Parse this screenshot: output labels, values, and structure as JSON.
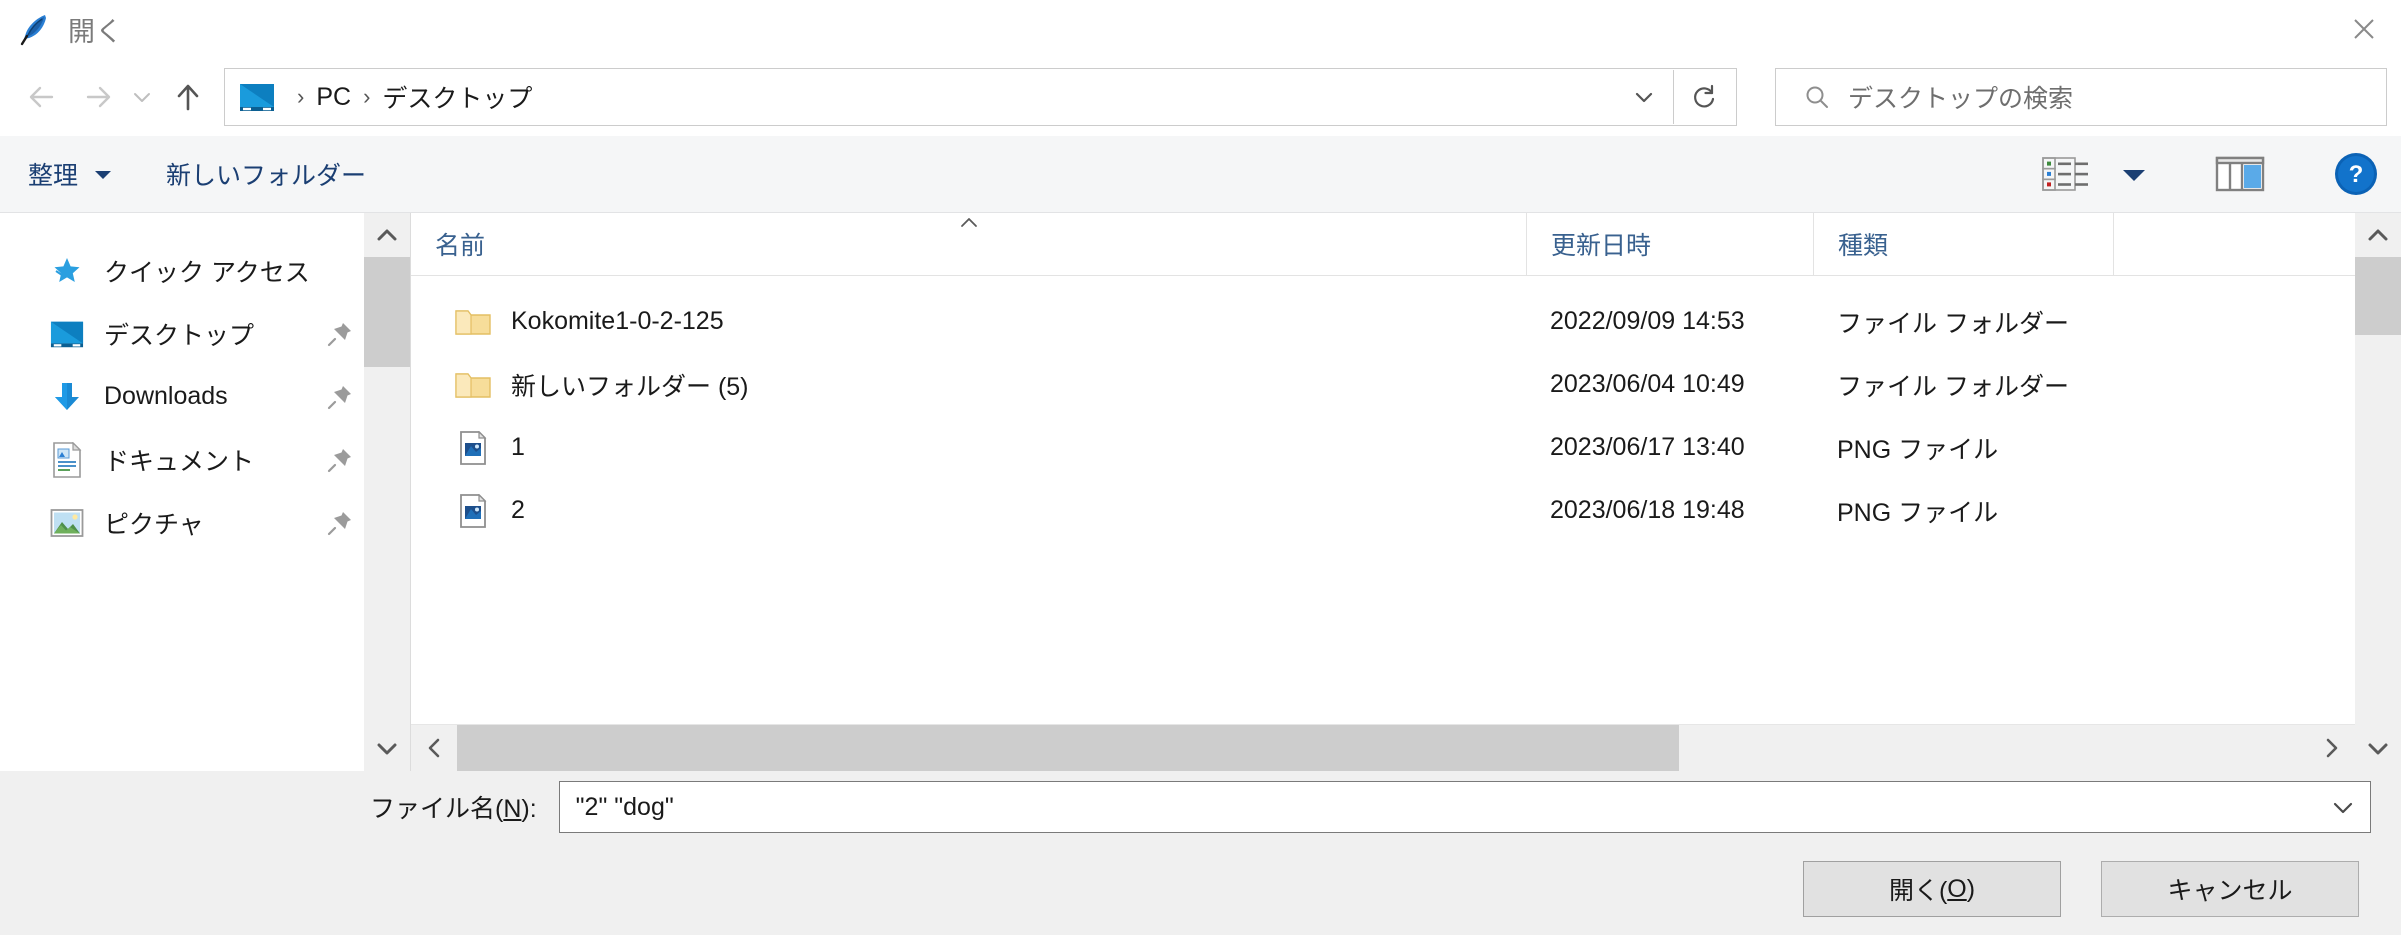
{
  "window": {
    "title": "開く",
    "title_icon": "feather-quill-icon",
    "close_label": "×"
  },
  "navigation": {
    "back_icon": "arrow-left-icon",
    "forward_icon": "arrow-right-icon",
    "recent_icon": "chevron-down-icon",
    "up_icon": "arrow-up-icon"
  },
  "breadcrumb": {
    "root_icon": "monitor-icon",
    "separator": "›",
    "items": [
      "PC",
      "デスクトップ"
    ],
    "dropdown_icon": "chevron-down-icon",
    "refresh_icon": "refresh-icon"
  },
  "search": {
    "icon": "search-icon",
    "placeholder": "デスクトップの検索",
    "value": ""
  },
  "toolbar": {
    "organize_label": "整理",
    "organize_caret_icon": "caret-down-icon",
    "new_folder_label": "新しいフォルダー",
    "view_icon": "view-options-icon",
    "view_caret_icon": "caret-down-icon",
    "preview_pane_icon": "preview-pane-icon",
    "help_icon": "help-question-icon"
  },
  "sidebar": {
    "items": [
      {
        "label": "クイック アクセス",
        "icon": "star-pin-icon",
        "pinned": false
      },
      {
        "label": "デスクトップ",
        "icon": "monitor-icon",
        "pinned": true
      },
      {
        "label": "Downloads",
        "icon": "download-arrow-icon",
        "pinned": true
      },
      {
        "label": "ドキュメント",
        "icon": "document-icon",
        "pinned": true
      },
      {
        "label": "ピクチャ",
        "icon": "picture-icon",
        "pinned": true
      }
    ],
    "pin_icon": "pin-icon"
  },
  "file_list": {
    "columns": [
      {
        "label": "名前",
        "sorted": true,
        "sort_icon": "caret-up-icon"
      },
      {
        "label": "更新日時",
        "sorted": false
      },
      {
        "label": "種類",
        "sorted": false
      }
    ],
    "rows": [
      {
        "name": "Kokomite1-0-2-125",
        "modified": "2022/09/09 14:53",
        "type": "ファイル フォルダー",
        "icon": "folder-icon"
      },
      {
        "name": "新しいフォルダー (5)",
        "modified": "2023/06/04 10:49",
        "type": "ファイル フォルダー",
        "icon": "folder-icon"
      },
      {
        "name": "1",
        "modified": "2023/06/17 13:40",
        "type": "PNG ファイル",
        "icon": "png-image-icon"
      },
      {
        "name": "2",
        "modified": "2023/06/18 19:48",
        "type": "PNG ファイル",
        "icon": "png-image-icon"
      }
    ]
  },
  "filename": {
    "label_prefix": "ファイル名(",
    "label_accel": "N",
    "label_suffix": "):",
    "value": "\"2\" \"dog\"",
    "dropdown_icon": "chevron-down-icon"
  },
  "buttons": {
    "open_prefix": "開く(",
    "open_accel": "O",
    "open_suffix": ")",
    "cancel_label": "キャンセル"
  },
  "scrollbars": {
    "up_icon": "chevron-up-icon",
    "down_icon": "chevron-down-icon",
    "left_icon": "chevron-left-icon",
    "right_icon": "chevron-right-icon"
  },
  "colors": {
    "accent_blue": "#0b6cc1",
    "toolbar_bg": "#f5f6f7",
    "bottom_bg": "#f0f0f0",
    "folder_yellow": "#f5d787",
    "link_blue": "#1b3f73",
    "column_header_blue": "#39618f"
  }
}
